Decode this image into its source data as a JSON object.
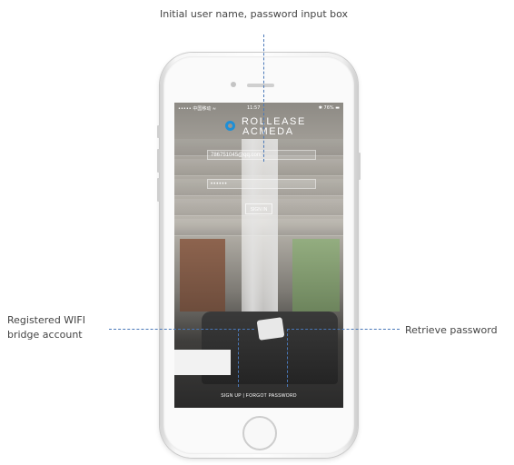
{
  "annotations": {
    "top": "Initial user name, password input box",
    "left_line1": "Registered WIFI",
    "left_line2": "bridge account",
    "right": "Retrieve password"
  },
  "status_bar": {
    "carrier": "••••• 中国移动 ≈",
    "time": "11:57",
    "battery": "✱ 76% ▬"
  },
  "brand": {
    "line1": "ROLLEASE",
    "line2": "ACMEDA",
    "accent_color": "#1f8fd6"
  },
  "login": {
    "username_value": "786751045@qq.com",
    "password_value": "••••••",
    "signin_label": "SIGN IN"
  },
  "footer": {
    "sign_up_label": "SIGN UP",
    "separator": "|",
    "forgot_label": "FORGOT PASSWORD"
  },
  "line_color": "#4a78b8"
}
